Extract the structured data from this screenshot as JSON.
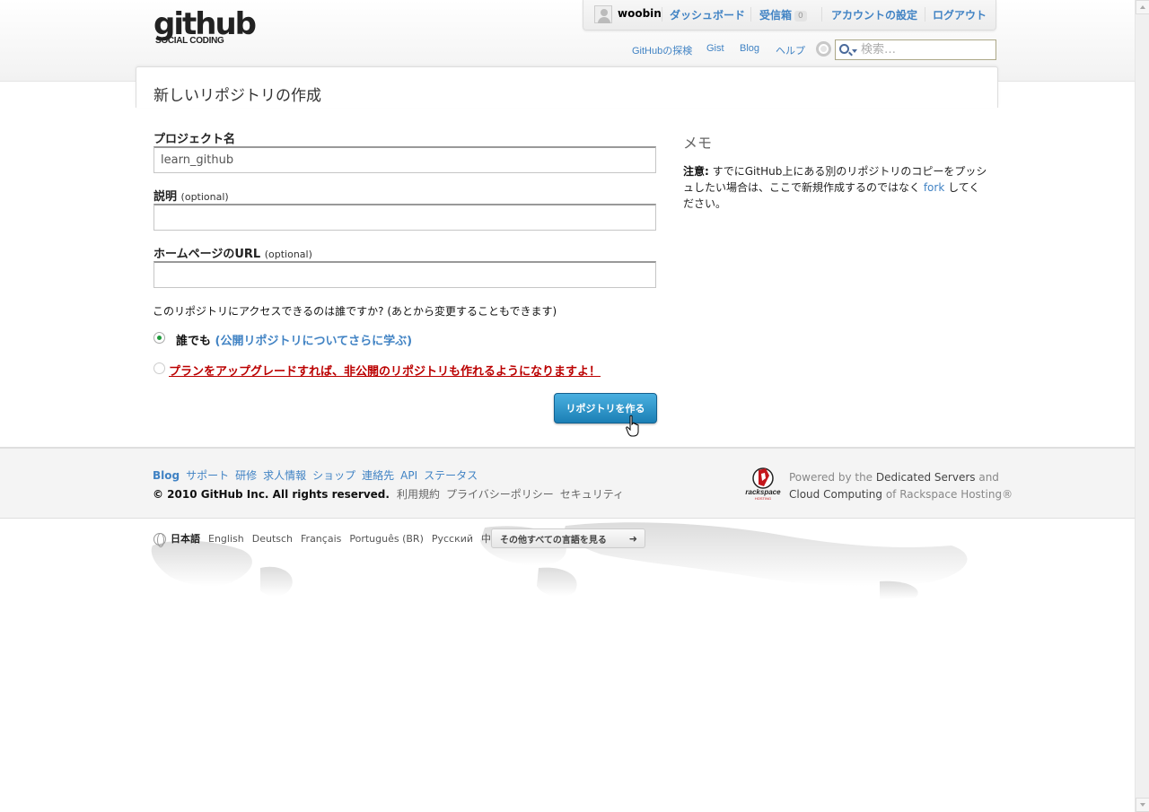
{
  "header": {
    "logo_text": "github",
    "logo_tagline": "SOCIAL CODING",
    "user": {
      "username": "woobin",
      "dashboard": "ダッシュボード",
      "inbox": "受信箱",
      "inbox_count": "0",
      "account_settings": "アカウントの設定",
      "logout": "ログアウト"
    },
    "subnav": {
      "explore": "GitHubの探検",
      "gist": "Gist",
      "blog": "Blog",
      "help": "ヘルプ"
    },
    "search": {
      "placeholder": "検索…"
    }
  },
  "page": {
    "title": "新しいリポジトリの作成"
  },
  "form": {
    "project_name_label": "プロジェクト名",
    "project_name_value": "learn_github",
    "description_label": "説明",
    "description_optional": "(optional)",
    "description_value": "",
    "homepage_label": "ホームページのURL",
    "homepage_optional": "(optional)",
    "homepage_value": "",
    "access_question": "このリポジトリにアクセスできるのは誰ですか? (あとから変更することもできます)",
    "public_label": "誰でも",
    "public_link": "(公開リポジトリについてさらに学ぶ)",
    "private_upgrade": "プランをアップグレードすれば、非公開のリポジトリも作れるようになりますよ！",
    "selected_access": "public",
    "submit_label": "リポジトリを作る"
  },
  "memo": {
    "title": "メモ",
    "note_label": "注意:",
    "note_before": " すでにGitHub上にある別のリポジトリのコピーをプッシュしたい場合は、ここで新規作成するのではなく ",
    "note_link": "fork",
    "note_after": " してください。"
  },
  "footer": {
    "links": [
      "Blog",
      "サポート",
      "研修",
      "求人情報",
      "ショップ",
      "連絡先",
      "API",
      "ステータス"
    ],
    "copyright": "© 2010 GitHub Inc. All rights reserved.",
    "legal": [
      "利用規約",
      "プライバシーポリシー",
      "セキュリティ"
    ],
    "powered_1": "Powered by the ",
    "powered_2": "Dedicated Servers",
    "powered_3": " and",
    "powered_4": "Cloud Computing",
    "powered_5": " of Rackspace Hosting®",
    "rackspace_logo_text": "rackspace",
    "rackspace_logo_sub": "HOSTING"
  },
  "languages": {
    "current": "日本語",
    "others": [
      "English",
      "Deutsch",
      "Français",
      "Português (BR)",
      "Русский",
      "中文"
    ],
    "more_button": "その他すべての言語を見る",
    "more_arrow": "➜"
  },
  "colors": {
    "link": "#4183c4",
    "error_red": "#bb0000",
    "button_blue": "#1b7fb5",
    "radio_green": "#1f9b3b"
  }
}
